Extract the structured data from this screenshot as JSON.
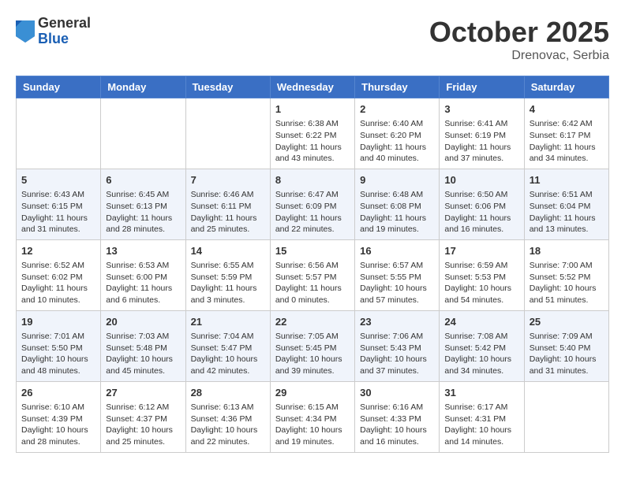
{
  "logo": {
    "general": "General",
    "blue": "Blue"
  },
  "title": "October 2025",
  "location": "Drenovac, Serbia",
  "days_of_week": [
    "Sunday",
    "Monday",
    "Tuesday",
    "Wednesday",
    "Thursday",
    "Friday",
    "Saturday"
  ],
  "weeks": [
    [
      {
        "day": "",
        "info": ""
      },
      {
        "day": "",
        "info": ""
      },
      {
        "day": "",
        "info": ""
      },
      {
        "day": "1",
        "info": "Sunrise: 6:38 AM\nSunset: 6:22 PM\nDaylight: 11 hours\nand 43 minutes."
      },
      {
        "day": "2",
        "info": "Sunrise: 6:40 AM\nSunset: 6:20 PM\nDaylight: 11 hours\nand 40 minutes."
      },
      {
        "day": "3",
        "info": "Sunrise: 6:41 AM\nSunset: 6:19 PM\nDaylight: 11 hours\nand 37 minutes."
      },
      {
        "day": "4",
        "info": "Sunrise: 6:42 AM\nSunset: 6:17 PM\nDaylight: 11 hours\nand 34 minutes."
      }
    ],
    [
      {
        "day": "5",
        "info": "Sunrise: 6:43 AM\nSunset: 6:15 PM\nDaylight: 11 hours\nand 31 minutes."
      },
      {
        "day": "6",
        "info": "Sunrise: 6:45 AM\nSunset: 6:13 PM\nDaylight: 11 hours\nand 28 minutes."
      },
      {
        "day": "7",
        "info": "Sunrise: 6:46 AM\nSunset: 6:11 PM\nDaylight: 11 hours\nand 25 minutes."
      },
      {
        "day": "8",
        "info": "Sunrise: 6:47 AM\nSunset: 6:09 PM\nDaylight: 11 hours\nand 22 minutes."
      },
      {
        "day": "9",
        "info": "Sunrise: 6:48 AM\nSunset: 6:08 PM\nDaylight: 11 hours\nand 19 minutes."
      },
      {
        "day": "10",
        "info": "Sunrise: 6:50 AM\nSunset: 6:06 PM\nDaylight: 11 hours\nand 16 minutes."
      },
      {
        "day": "11",
        "info": "Sunrise: 6:51 AM\nSunset: 6:04 PM\nDaylight: 11 hours\nand 13 minutes."
      }
    ],
    [
      {
        "day": "12",
        "info": "Sunrise: 6:52 AM\nSunset: 6:02 PM\nDaylight: 11 hours\nand 10 minutes."
      },
      {
        "day": "13",
        "info": "Sunrise: 6:53 AM\nSunset: 6:00 PM\nDaylight: 11 hours\nand 6 minutes."
      },
      {
        "day": "14",
        "info": "Sunrise: 6:55 AM\nSunset: 5:59 PM\nDaylight: 11 hours\nand 3 minutes."
      },
      {
        "day": "15",
        "info": "Sunrise: 6:56 AM\nSunset: 5:57 PM\nDaylight: 11 hours\nand 0 minutes."
      },
      {
        "day": "16",
        "info": "Sunrise: 6:57 AM\nSunset: 5:55 PM\nDaylight: 10 hours\nand 57 minutes."
      },
      {
        "day": "17",
        "info": "Sunrise: 6:59 AM\nSunset: 5:53 PM\nDaylight: 10 hours\nand 54 minutes."
      },
      {
        "day": "18",
        "info": "Sunrise: 7:00 AM\nSunset: 5:52 PM\nDaylight: 10 hours\nand 51 minutes."
      }
    ],
    [
      {
        "day": "19",
        "info": "Sunrise: 7:01 AM\nSunset: 5:50 PM\nDaylight: 10 hours\nand 48 minutes."
      },
      {
        "day": "20",
        "info": "Sunrise: 7:03 AM\nSunset: 5:48 PM\nDaylight: 10 hours\nand 45 minutes."
      },
      {
        "day": "21",
        "info": "Sunrise: 7:04 AM\nSunset: 5:47 PM\nDaylight: 10 hours\nand 42 minutes."
      },
      {
        "day": "22",
        "info": "Sunrise: 7:05 AM\nSunset: 5:45 PM\nDaylight: 10 hours\nand 39 minutes."
      },
      {
        "day": "23",
        "info": "Sunrise: 7:06 AM\nSunset: 5:43 PM\nDaylight: 10 hours\nand 37 minutes."
      },
      {
        "day": "24",
        "info": "Sunrise: 7:08 AM\nSunset: 5:42 PM\nDaylight: 10 hours\nand 34 minutes."
      },
      {
        "day": "25",
        "info": "Sunrise: 7:09 AM\nSunset: 5:40 PM\nDaylight: 10 hours\nand 31 minutes."
      }
    ],
    [
      {
        "day": "26",
        "info": "Sunrise: 6:10 AM\nSunset: 4:39 PM\nDaylight: 10 hours\nand 28 minutes."
      },
      {
        "day": "27",
        "info": "Sunrise: 6:12 AM\nSunset: 4:37 PM\nDaylight: 10 hours\nand 25 minutes."
      },
      {
        "day": "28",
        "info": "Sunrise: 6:13 AM\nSunset: 4:36 PM\nDaylight: 10 hours\nand 22 minutes."
      },
      {
        "day": "29",
        "info": "Sunrise: 6:15 AM\nSunset: 4:34 PM\nDaylight: 10 hours\nand 19 minutes."
      },
      {
        "day": "30",
        "info": "Sunrise: 6:16 AM\nSunset: 4:33 PM\nDaylight: 10 hours\nand 16 minutes."
      },
      {
        "day": "31",
        "info": "Sunrise: 6:17 AM\nSunset: 4:31 PM\nDaylight: 10 hours\nand 14 minutes."
      },
      {
        "day": "",
        "info": ""
      }
    ]
  ]
}
